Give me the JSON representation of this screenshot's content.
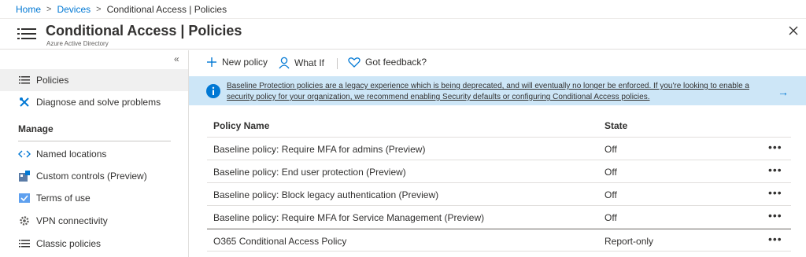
{
  "breadcrumb": {
    "home": "Home",
    "devices": "Devices",
    "current": "Conditional Access | Policies"
  },
  "header": {
    "title": "Conditional Access | Policies",
    "subtitle": "Azure Active Directory",
    "icon": "list-icon",
    "close_icon": "close-icon"
  },
  "sidebar": {
    "collapse_glyph": "«",
    "items": [
      {
        "label": "Policies",
        "icon": "list-icon"
      },
      {
        "label": "Diagnose and solve problems",
        "icon": "tools-icon"
      }
    ],
    "section_title": "Manage",
    "manage_items": [
      {
        "label": "Named locations",
        "icon": "named-locations-icon"
      },
      {
        "label": "Custom controls (Preview)",
        "icon": "custom-controls-icon"
      },
      {
        "label": "Terms of use",
        "icon": "terms-icon"
      },
      {
        "label": "VPN connectivity",
        "icon": "gear-icon"
      },
      {
        "label": "Classic policies",
        "icon": "list-icon"
      }
    ]
  },
  "toolbar": {
    "new_policy": "New policy",
    "what_if": "What If",
    "feedback": "Got feedback?"
  },
  "banner": {
    "text": "Baseline Protection policies are a legacy experience which is being deprecated, and will eventually no longer be enforced. If you're looking to enable a security policy for your organization, we recommend enabling Security defaults or configuring Conditional Access policies.",
    "arrow": "→"
  },
  "table": {
    "columns": [
      "Policy Name",
      "State"
    ],
    "more_glyph": "•••",
    "rows": [
      {
        "name": "Baseline policy: Require MFA for admins (Preview)",
        "state": "Off"
      },
      {
        "name": "Baseline policy: End user protection (Preview)",
        "state": "Off"
      },
      {
        "name": "Baseline policy: Block legacy authentication (Preview)",
        "state": "Off"
      },
      {
        "name": "Baseline policy: Require MFA for Service Management (Preview)",
        "state": "Off"
      },
      {
        "name": "O365 Conditional Access Policy",
        "state": "Report-only"
      }
    ]
  },
  "colors": {
    "accent": "#0078d4",
    "banner_bg": "#cde6f7",
    "selected_nav": "#f0f0f0"
  }
}
